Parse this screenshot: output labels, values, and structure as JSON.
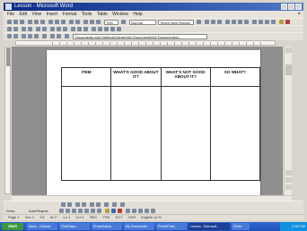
{
  "window": {
    "title": "Lesson - Microsoft Word",
    "close_glyph": "×"
  },
  "menubar": {
    "items": [
      "File",
      "Edit",
      "View",
      "Insert",
      "Format",
      "Tools",
      "Table",
      "Window",
      "Help"
    ]
  },
  "toolbar": {
    "zoom": "75%",
    "style": "Normal",
    "font": "Times New Roman",
    "address": "Documents and Settings\\Owner\\My Documents\\My Documents\\s..."
  },
  "table": {
    "headers": [
      "ITEM",
      "WHAT'S GOOD ABOUT IT?",
      "WHAT'S NOT GOOD ABOUT IT?",
      "SO WHAT?"
    ]
  },
  "draw_toolbar": {
    "draw_label": "Draw",
    "autoshapes_label": "AutoShapes"
  },
  "status_bar": {
    "items": [
      "Page 1",
      "Sec 1",
      "1/1",
      "At 1\"",
      "Ln 1",
      "Col 1",
      "REC",
      "TRK",
      "EXT",
      "OVR",
      "English (U.S."
    ]
  },
  "taskbar": {
    "start_label": "start",
    "tasks": [
      "Inbox - Outlook",
      "FirstClass...",
      "Presentation...",
      "My Documents",
      "PowerPoint...",
      "Lesson - Microsoft...",
      "Photo"
    ],
    "clock": "2:30 PM"
  },
  "colors": {
    "title_bar": "#0a2a86",
    "taskbar": "#1f4fb8",
    "start_button": "#3c9a3c",
    "workspace": "#8f8f8f"
  }
}
